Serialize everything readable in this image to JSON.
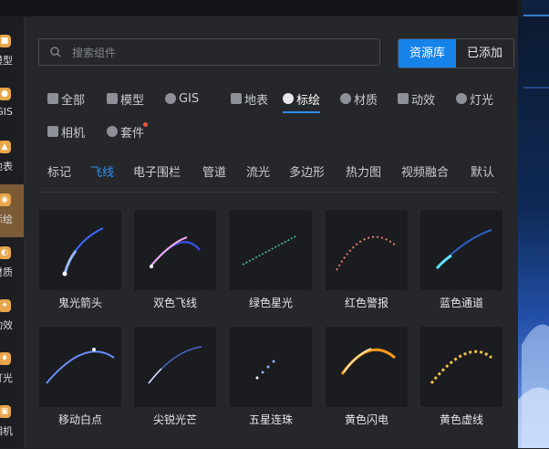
{
  "left_rail": [
    {
      "label": "模型",
      "icon": "model-icon"
    },
    {
      "label": "GIS",
      "icon": "gis-icon"
    },
    {
      "label": "地表",
      "icon": "surface-icon"
    },
    {
      "label": "标绘",
      "icon": "plot-icon",
      "active": true
    },
    {
      "label": "材质",
      "icon": "material-icon"
    },
    {
      "label": "动效",
      "icon": "effect-icon"
    },
    {
      "label": "灯光",
      "icon": "light-icon"
    },
    {
      "label": "相机",
      "icon": "camera-icon"
    }
  ],
  "search": {
    "placeholder": "搜索组件"
  },
  "library_tabs": [
    "资源库",
    "已添加"
  ],
  "categories": [
    "全部",
    "模型",
    "GIS",
    "地表",
    "标绘",
    "材质",
    "动效",
    "灯光",
    "相机",
    "套件"
  ],
  "subtabs": [
    "标记",
    "飞线",
    "电子围栏",
    "管道",
    "流光",
    "多边形",
    "热力图",
    "视频融合",
    "默认"
  ],
  "items": [
    "鬼光箭头",
    "双色飞线",
    "绿色星光",
    "红色警报",
    "蓝色通道",
    "移动白点",
    "尖锐光芒",
    "五星连珠",
    "黄色闪电",
    "黄色虚线"
  ],
  "colors": {
    "accent": "#1583e8",
    "active_rail": "#7c5a35",
    "badge": "#f0523c"
  }
}
